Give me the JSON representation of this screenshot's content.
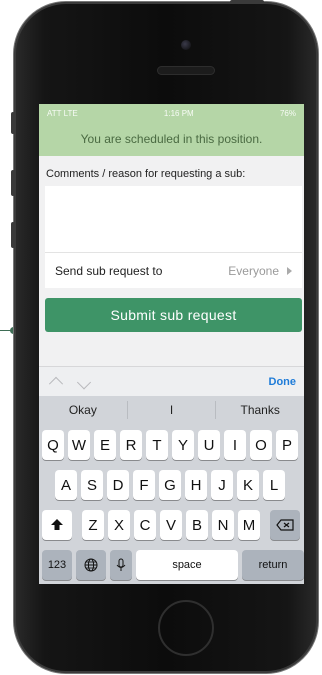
{
  "status_bar": {
    "carrier": "ATT LTE",
    "time": "1:16 PM",
    "battery": "76%"
  },
  "banner": {
    "text": "You are scheduled in this position."
  },
  "form": {
    "comments_label": "Comments / reason for requesting a sub:",
    "comments_value": "",
    "send_to_label": "Send sub request to",
    "send_to_value": "Everyone",
    "submit_label": "Submit sub request"
  },
  "accessory_bar": {
    "done_label": "Done"
  },
  "keyboard": {
    "suggestions": [
      "Okay",
      "I",
      "Thanks"
    ],
    "row1": [
      "Q",
      "W",
      "E",
      "R",
      "T",
      "Y",
      "U",
      "I",
      "O",
      "P"
    ],
    "row2": [
      "A",
      "S",
      "D",
      "F",
      "G",
      "H",
      "J",
      "K",
      "L"
    ],
    "row3": [
      "Z",
      "X",
      "C",
      "V",
      "B",
      "N",
      "M"
    ],
    "numbers_key": "123",
    "space_key": "space",
    "return_key": "return"
  },
  "colors": {
    "banner_bg": "#b5d6a7",
    "submit_bg": "#3e9467",
    "done": "#1e7bd8"
  }
}
